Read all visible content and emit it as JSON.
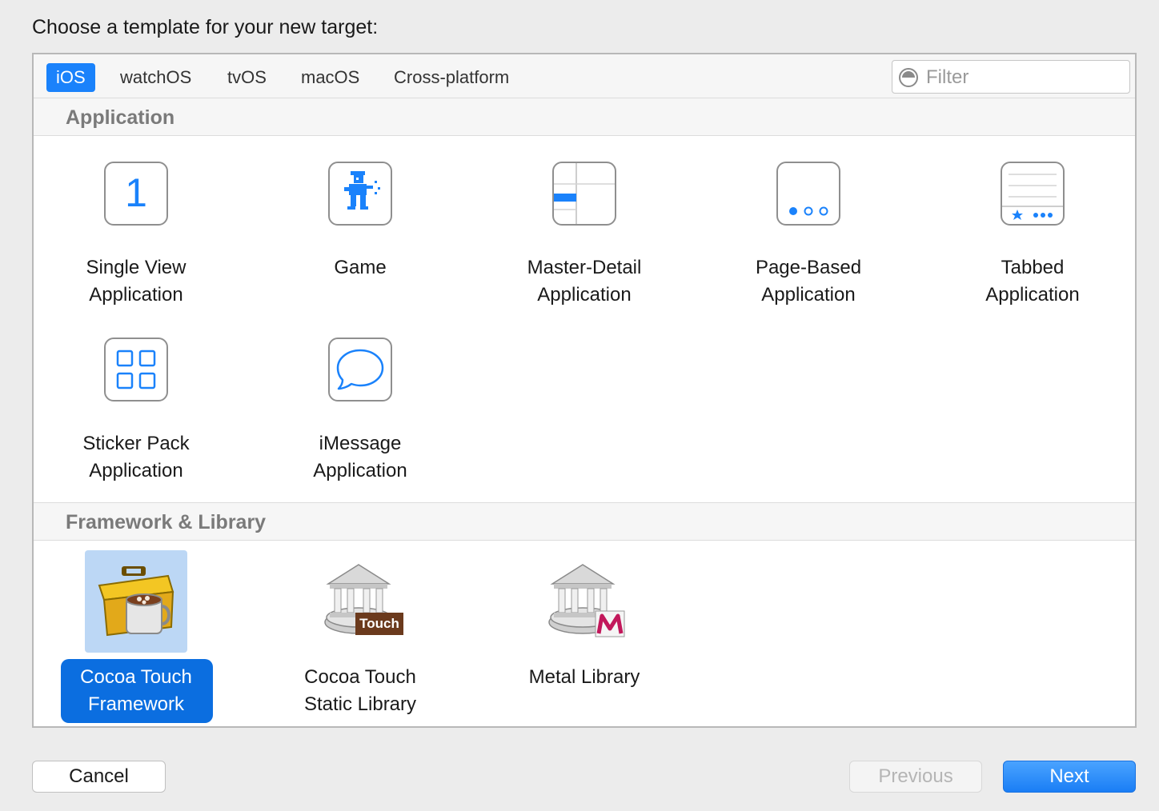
{
  "prompt": "Choose a template for your new target:",
  "tabs": [
    {
      "label": "iOS",
      "active": true
    },
    {
      "label": "watchOS"
    },
    {
      "label": "tvOS"
    },
    {
      "label": "macOS"
    },
    {
      "label": "Cross-platform"
    }
  ],
  "filter": {
    "placeholder": "Filter"
  },
  "sections": {
    "application": {
      "title": "Application",
      "items": [
        {
          "line1": "Single View",
          "line2": "Application",
          "icon": "single-view-icon"
        },
        {
          "line1": "Game",
          "line2": "",
          "icon": "game-icon"
        },
        {
          "line1": "Master-Detail",
          "line2": "Application",
          "icon": "master-detail-icon"
        },
        {
          "line1": "Page-Based",
          "line2": "Application",
          "icon": "page-based-icon"
        },
        {
          "line1": "Tabbed",
          "line2": "Application",
          "icon": "tabbed-icon"
        },
        {
          "line1": "Sticker Pack",
          "line2": "Application",
          "icon": "sticker-pack-icon"
        },
        {
          "line1": "iMessage",
          "line2": "Application",
          "icon": "imessage-icon"
        }
      ]
    },
    "framework": {
      "title": "Framework & Library",
      "items": [
        {
          "line1": "Cocoa Touch",
          "line2": "Framework",
          "icon": "toolbox-icon",
          "selected": true
        },
        {
          "line1": "Cocoa Touch",
          "line2": "Static Library",
          "icon": "library-touch-icon",
          "badge": "Touch"
        },
        {
          "line1": "Metal Library",
          "line2": "",
          "icon": "library-metal-icon"
        }
      ]
    }
  },
  "single_view_glyph": "1",
  "buttons": {
    "cancel": "Cancel",
    "previous": "Previous",
    "next": "Next"
  },
  "colors": {
    "accent": "#1a82fb",
    "selection": "#0b6ee0",
    "selection_light": "#bcd7f5"
  }
}
